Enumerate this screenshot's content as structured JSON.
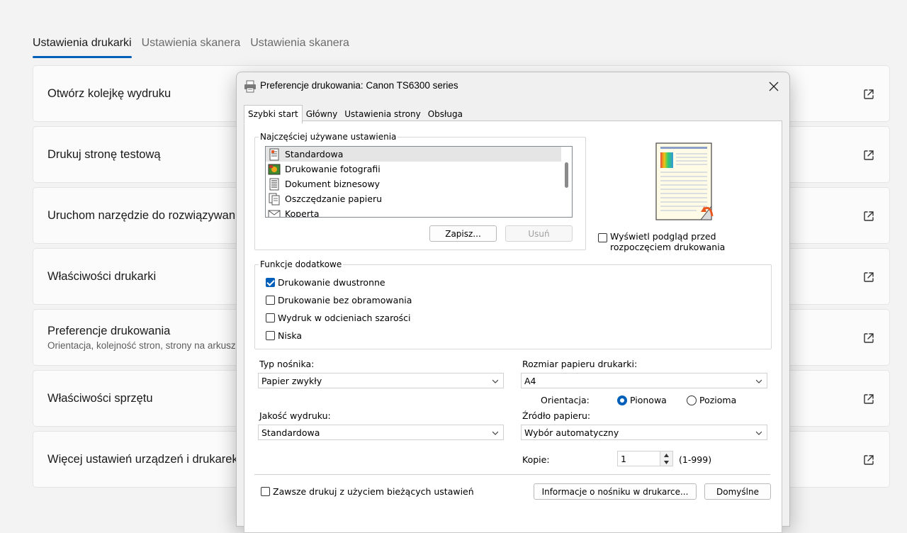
{
  "settings": {
    "tabs": [
      "Ustawienia drukarki",
      "Ustawienia skanera",
      "Ustawienia skanera"
    ],
    "cards": [
      {
        "label": "Otwórz kolejkę wydruku",
        "sub": ""
      },
      {
        "label": "Drukuj stronę testową",
        "sub": ""
      },
      {
        "label": "Uruchom narzędzie do rozwiązywania problemów",
        "sub": ""
      },
      {
        "label": "Właściwości drukarki",
        "sub": ""
      },
      {
        "label": "Preferencje drukowania",
        "sub": "Orientacja, kolejność stron, strony na arkusz"
      },
      {
        "label": "Właściwości sprzętu",
        "sub": ""
      },
      {
        "label": "Więcej ustawień urządzeń i drukarek",
        "sub": ""
      }
    ]
  },
  "dialog": {
    "title": "Preferencje drukowania: Canon TS6300 series",
    "tabs": [
      "Szybki start",
      "Główny",
      "Ustawienia strony",
      "Obsługa"
    ],
    "common_settings": {
      "legend": "Najczęściej używane ustawienia",
      "items": [
        "Standardowa",
        "Drukowanie fotografii",
        "Dokument biznesowy",
        "Oszczędzanie papieru",
        "Koperta"
      ],
      "selected": "Standardowa",
      "save_label": "Zapisz...",
      "delete_label": "Usuń"
    },
    "preview_checkbox": {
      "label": "Wyświetl podgląd przed rozpoczęciem drukowania",
      "checked": false
    },
    "additional": {
      "legend": "Funkcje dodatkowe",
      "options": [
        {
          "label": "Drukowanie dwustronne",
          "checked": true
        },
        {
          "label": "Drukowanie bez obramowania",
          "checked": false
        },
        {
          "label": "Wydruk w odcieniach szarości",
          "checked": false
        },
        {
          "label": "Niska",
          "checked": false
        }
      ]
    },
    "media_type": {
      "label": "Typ nośnika:",
      "value": "Papier zwykły"
    },
    "paper_size": {
      "label": "Rozmiar papieru drukarki:",
      "value": "A4"
    },
    "orientation": {
      "label": "Orientacja:",
      "portrait": "Pionowa",
      "landscape": "Pozioma",
      "selected": "Pionowa"
    },
    "print_quality": {
      "label": "Jakość wydruku:",
      "value": "Standardowa"
    },
    "paper_source": {
      "label": "Źródło papieru:",
      "value": "Wybór automatyczny"
    },
    "copies": {
      "label": "Kopie:",
      "value": "1",
      "range": "(1-999)"
    },
    "always_print": {
      "label": "Zawsze drukuj z użyciem bieżących ustawień",
      "checked": false
    },
    "media_info_label": "Informacje o nośniku w drukarce...",
    "defaults_label": "Domyślne"
  },
  "colors": {
    "accent": "#005fb8"
  }
}
